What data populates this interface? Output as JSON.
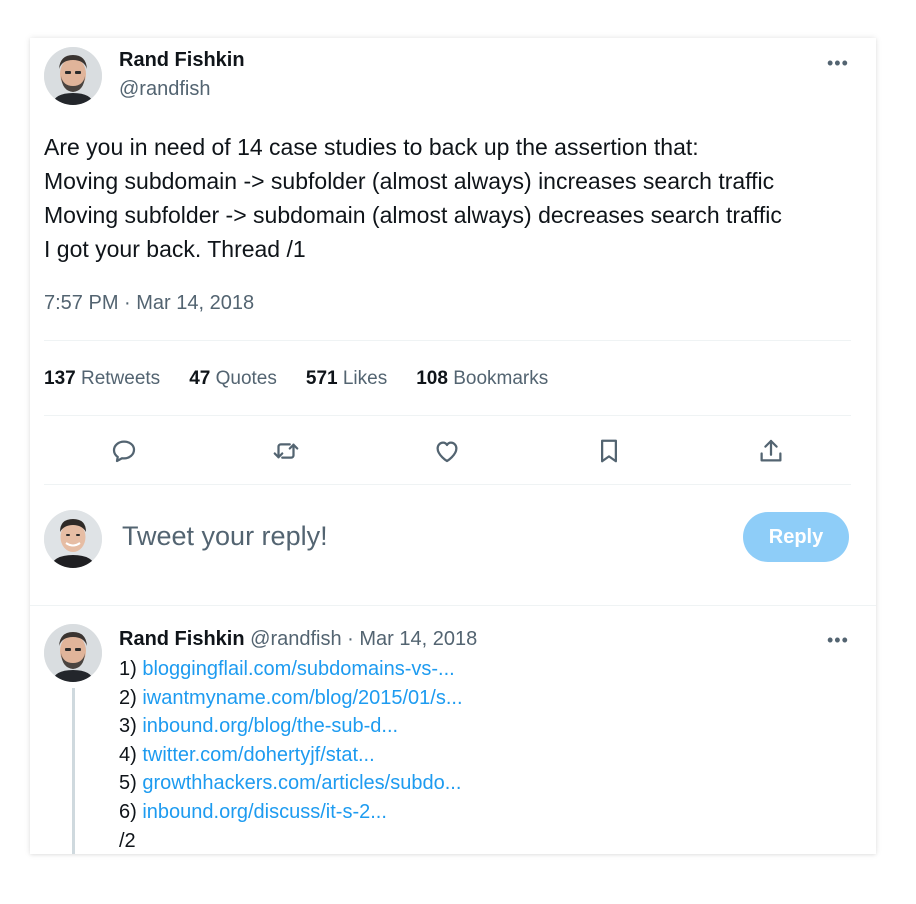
{
  "tweet": {
    "author_name": "Rand Fishkin",
    "author_handle": "@randfish",
    "more_label": "•••",
    "text_lines": [
      "Are you in need of 14 case studies to back up the assertion that:",
      "Moving subdomain -> subfolder (almost always) increases search traffic",
      "Moving subfolder -> subdomain (almost always) decreases search traffic",
      "I got your back. Thread /1"
    ],
    "timestamp": "7:57 PM · Mar 14, 2018"
  },
  "stats": [
    {
      "count": "137",
      "label": "Retweets"
    },
    {
      "count": "47",
      "label": "Quotes"
    },
    {
      "count": "571",
      "label": "Likes"
    },
    {
      "count": "108",
      "label": "Bookmarks"
    }
  ],
  "actions": [
    "reply-icon",
    "retweet-icon",
    "like-heart-icon",
    "bookmark-icon",
    "share-icon"
  ],
  "reply_box": {
    "placeholder": "Tweet your reply!",
    "button_label": "Reply",
    "button_color": "#8ecdf8"
  },
  "thread_tweet": {
    "author_name": "Rand Fishkin",
    "author_handle": "@randfish",
    "date": "· Mar 14, 2018",
    "more_label": "•••",
    "items": [
      {
        "num": "1)",
        "link": "bloggingflail.com/subdomains-vs-..."
      },
      {
        "num": "2)",
        "link": "iwantmyname.com/blog/2015/01/s..."
      },
      {
        "num": "3)",
        "link": "inbound.org/blog/the-sub-d..."
      },
      {
        "num": "4)",
        "link": "twitter.com/dohertyjf/stat..."
      },
      {
        "num": "5)",
        "link": "growthhackers.com/articles/subdo..."
      },
      {
        "num": "6)",
        "link": "inbound.org/discuss/it-s-2..."
      }
    ],
    "footer": "/2"
  },
  "colors": {
    "link": "#1d9bf0",
    "secondary_text": "#536471",
    "primary_text": "#0f1419"
  }
}
